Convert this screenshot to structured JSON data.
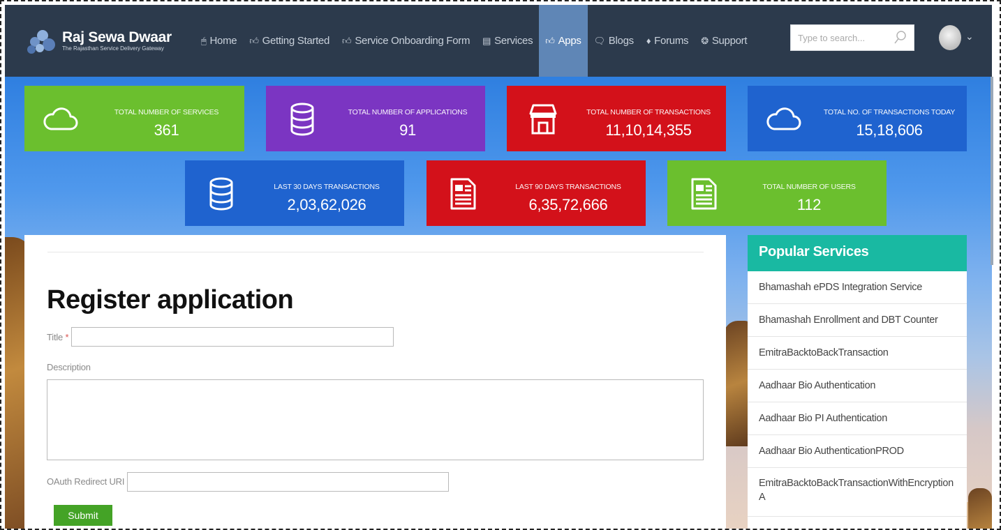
{
  "brand": {
    "title": "Raj Sewa Dwaar",
    "subtitle": "The Rajasthan Service Delivery Gateway"
  },
  "nav": {
    "items": [
      {
        "label": "Home",
        "icon": "monitor-icon"
      },
      {
        "label": "Getting Started",
        "icon": "thumbs-up-icon"
      },
      {
        "label": "Service Onboarding Form",
        "icon": "thumbs-up-icon"
      },
      {
        "label": "Services",
        "icon": "server-icon"
      },
      {
        "label": "Apps",
        "icon": "thumbs-up-icon",
        "active": true
      },
      {
        "label": "Blogs",
        "icon": "chat-icon"
      },
      {
        "label": "Forums",
        "icon": "diamond-icon"
      },
      {
        "label": "Support",
        "icon": "lifebuoy-icon"
      }
    ]
  },
  "search": {
    "placeholder": "Type to search..."
  },
  "stats": [
    {
      "label": "TOTAL NUMBER OF SERVICES",
      "value": "361",
      "icon": "cloud-icon",
      "color": "#6bbf2e"
    },
    {
      "label": "TOTAL NUMBER OF APPLICATIONS",
      "value": "91",
      "icon": "database-icon",
      "color": "#7b35c2"
    },
    {
      "label": "TOTAL NUMBER OF TRANSACTIONS",
      "value": "11,10,14,355",
      "icon": "store-icon",
      "color": "#d3111a"
    },
    {
      "label": "TOTAL NO. OF TRANSACTIONS TODAY",
      "value": "15,18,606",
      "icon": "cloud-icon",
      "color": "#1f63cf"
    },
    {
      "label": "LAST 30 DAYS TRANSACTIONS",
      "value": "2,03,62,026",
      "icon": "database-icon",
      "color": "#1f63cf"
    },
    {
      "label": "LAST 90 DAYS TRANSACTIONS",
      "value": "6,35,72,666",
      "icon": "document-icon",
      "color": "#d3111a"
    },
    {
      "label": "TOTAL NUMBER OF USERS",
      "value": "112",
      "icon": "document-icon",
      "color": "#6bbf2e"
    }
  ],
  "form": {
    "heading": "Register application",
    "title_label": "Title",
    "title_required": "*",
    "title_value": "",
    "description_label": "Description",
    "description_value": "",
    "redirect_label": "OAuth Redirect URI",
    "redirect_value": "",
    "submit_label": "Submit"
  },
  "popular": {
    "heading": "Popular Services",
    "items": [
      "Bhamashah ePDS Integration Service",
      "Bhamashah Enrollment and DBT Counter",
      "EmitraBacktoBackTransaction",
      "Aadhaar Bio Authentication",
      "Aadhaar Bio PI Authentication",
      "Aadhaar Bio AuthenticationPROD",
      "EmitraBacktoBackTransactionWithEncryption A"
    ]
  }
}
